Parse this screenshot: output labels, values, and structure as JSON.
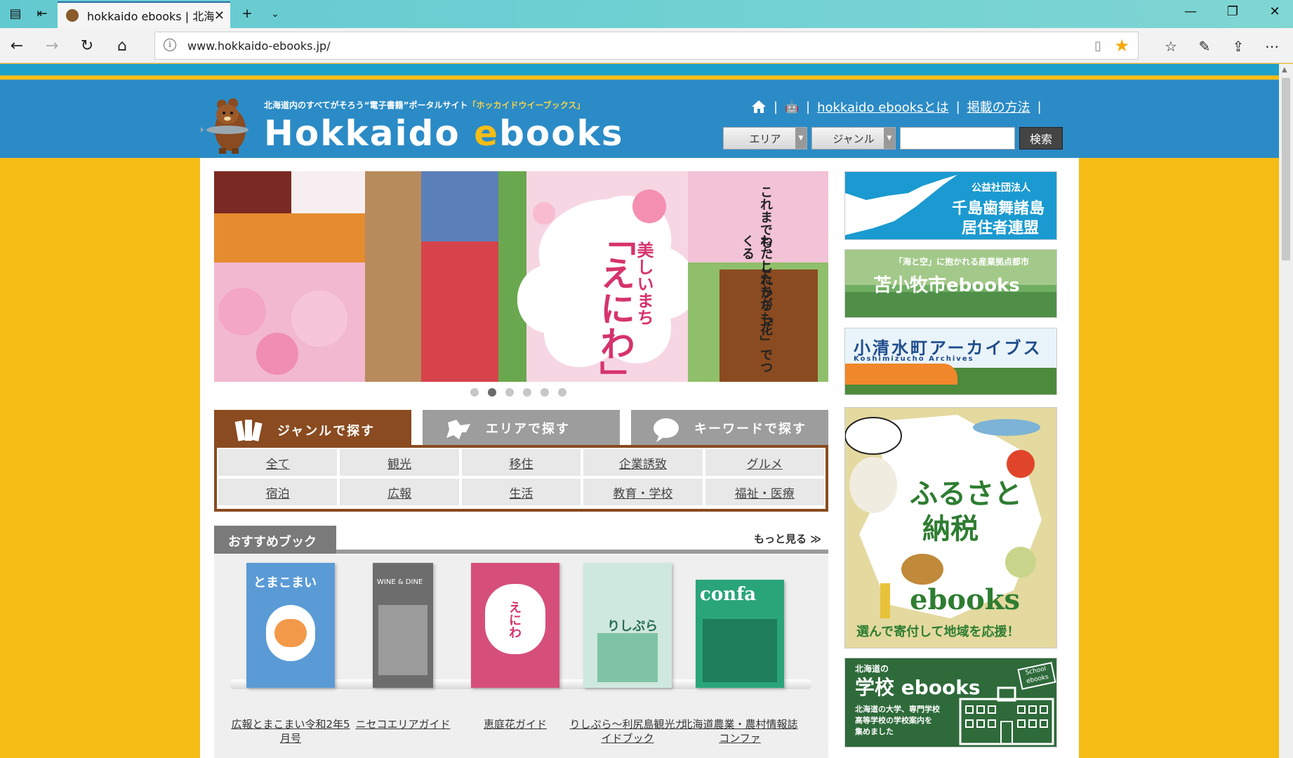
{
  "browser": {
    "tab_title": "hokkaido ebooks | 北海",
    "url": "www.hokkaido-ebooks.jp/"
  },
  "header": {
    "tagline_a": "北海道内のすべてがそろう“電子書籍”ポータルサイト",
    "tagline_b": "「ホッカイドウイーブックス」",
    "logo_a": "Hokkaido ",
    "logo_e": "e",
    "logo_b": "books",
    "links": {
      "about": "hokkaido ebooksとは",
      "howto": "掲載の方法"
    },
    "separator": "|",
    "area_select": "エリア",
    "genre_select": "ジャンル",
    "search_button": "検索"
  },
  "banner": {
    "vertical_text_1": "これまでも、これからも",
    "vertical_text_2": "わたしたちが「花」でつくる",
    "title_small": "美しいまち",
    "title_big": "「えにわ」",
    "slide_count": 6,
    "active_slide": 2
  },
  "search_tabs": [
    {
      "label": "ジャンルで探す",
      "active": true
    },
    {
      "label": "エリアで探す",
      "active": false
    },
    {
      "label": "キーワードで探す",
      "active": false
    }
  ],
  "genres": [
    "全て",
    "観光",
    "移住",
    "企業誘致",
    "グルメ",
    "宿泊",
    "広報",
    "生活",
    "教育・学校",
    "福祉・医療"
  ],
  "recommended": {
    "heading": "おすすめブック",
    "more": "もっと見る",
    "books": [
      {
        "title": "広報とまこまい令和2年5月号",
        "cover_text": "とまこまい",
        "color": "#5a9bd6"
      },
      {
        "title": "ニセコエリアガイド",
        "cover_text": "WINE & DINE",
        "color": "#6d6d6d"
      },
      {
        "title": "恵庭花ガイド",
        "cover_text": "えにわ",
        "color": "#d64f7a"
      },
      {
        "title": "りしぷら～利尻島観光ガイドブック",
        "cover_text": "りしぷら",
        "color": "#7fc3a6"
      },
      {
        "title": "北海道農業・農村情報誌コンファ",
        "cover_text": "confa",
        "color": "#2aa57a"
      }
    ]
  },
  "side_banners": {
    "chishima_a": "公益社団法人",
    "chishima_b": "千島歯舞諸島",
    "chishima_c": "居住者連盟",
    "tomakomai_small": "「海と空」に抱かれる産業拠点都市",
    "tomakomai": "苫小牧市ebooks",
    "koshimizu": "小清水町アーカイブス",
    "koshimizu_en": "Koshimizucho Archives",
    "furusato_a": "ふるさと",
    "furusato_b": "納税",
    "furusato_c": "ebooks",
    "furusato_d": "選んで寄付して地域を応援！",
    "school_a": "北海道の",
    "school_b": "学校 ebooks",
    "school_c": "北海道の大学、専門学校",
    "school_d": "高等学校の学校案内を",
    "school_e": "集めました",
    "school_badge": "School ebooks"
  }
}
